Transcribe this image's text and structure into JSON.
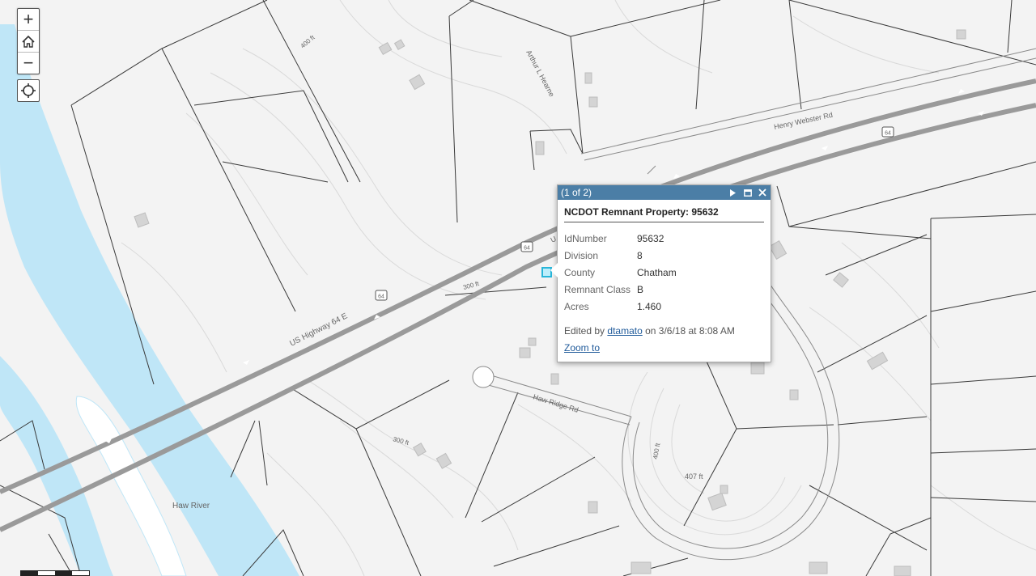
{
  "map": {
    "labels": {
      "highway": "US Highway 64 E",
      "henry_webster": "Henry Webster Rd",
      "arthur_hearne": "Arthur L Hearne",
      "haw_ridge": "Haw Ridge Rd",
      "haw_river": "Haw River",
      "shield_1": "64",
      "shield_2": "64",
      "shield_3": "64",
      "contour_400_top": "400 ft",
      "contour_300_mid": "300 ft",
      "contour_300_low": "300 ft",
      "contour_400_loop": "400 ft",
      "spot_elev": "407 ft",
      "road_fragment": "U"
    },
    "colors": {
      "background": "#f3f3f3",
      "river": "#bfe6f7",
      "highway": "#9a9a9a",
      "parcel_lines": "#3a3a3a",
      "building": "#d4d4d4",
      "selection": "#29b6d9"
    }
  },
  "controls": {
    "zoom_in": "+",
    "zoom_out": "−"
  },
  "popup": {
    "counter": "(1 of 2)",
    "title": "NCDOT Remnant Property: 95632",
    "attributes": [
      {
        "key": "IdNumber",
        "value": "95632"
      },
      {
        "key": "Division",
        "value": "8"
      },
      {
        "key": "County",
        "value": "Chatham"
      },
      {
        "key": "Remnant Class",
        "value": "B"
      },
      {
        "key": "Acres",
        "value": "1.460"
      }
    ],
    "edited_prefix": "Edited by",
    "edited_user": "dtamato",
    "edited_suffix": "on 3/6/18 at 8:08 AM",
    "zoom_to": "Zoom to",
    "header_color": "#4b7ea6"
  }
}
